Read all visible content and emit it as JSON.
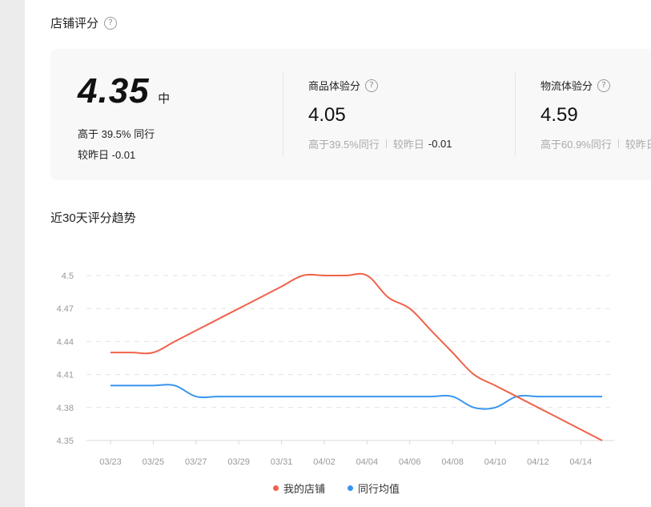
{
  "header": {
    "title": "店铺评分",
    "help_icon": "question-circle-icon"
  },
  "overall": {
    "score": "4.35",
    "level": "中",
    "percentile_text": "高于 39.5% 同行",
    "change_text": "较昨日 -0.01"
  },
  "metrics": [
    {
      "title": "商品体验分",
      "score": "4.05",
      "percentile_text": "高于39.5%同行",
      "change_label": "较昨日",
      "change_value": "-0.01"
    },
    {
      "title": "物流体验分",
      "score": "4.59",
      "percentile_text": "高于60.9%同行",
      "change_label": "较昨日",
      "change_value": ""
    }
  ],
  "trend": {
    "title": "近30天评分趋势"
  },
  "colors": {
    "my_store": "#f0624a",
    "peer_avg": "#3a94ee"
  },
  "chart_data": {
    "type": "line",
    "x": [
      "03/23",
      "03/24",
      "03/25",
      "03/26",
      "03/27",
      "03/28",
      "03/29",
      "03/30",
      "03/31",
      "04/01",
      "04/02",
      "04/03",
      "04/04",
      "04/05",
      "04/06",
      "04/07",
      "04/08",
      "04/09",
      "04/10",
      "04/11",
      "04/12",
      "04/13",
      "04/14",
      "04/15"
    ],
    "x_tick_labels": [
      "03/23",
      "03/25",
      "03/27",
      "03/29",
      "03/31",
      "04/02",
      "04/04",
      "04/06",
      "04/08",
      "04/10",
      "04/12",
      "04/14"
    ],
    "y_tick_labels": [
      "4.5",
      "4.47",
      "4.44",
      "4.41",
      "4.38",
      "4.35"
    ],
    "ylim": [
      4.35,
      4.5
    ],
    "grid": true,
    "legend_position": "bottom",
    "series": [
      {
        "name": "我的店铺",
        "color": "#f0624a",
        "values": [
          4.43,
          4.43,
          4.43,
          4.44,
          4.45,
          4.46,
          4.47,
          4.48,
          4.49,
          4.5,
          4.5,
          4.5,
          4.5,
          4.48,
          4.47,
          4.45,
          4.43,
          4.41,
          4.4,
          4.39,
          4.38,
          4.37,
          4.36,
          4.35
        ]
      },
      {
        "name": "同行均值",
        "color": "#3a94ee",
        "values": [
          4.4,
          4.4,
          4.4,
          4.4,
          4.39,
          4.39,
          4.39,
          4.39,
          4.39,
          4.39,
          4.39,
          4.39,
          4.39,
          4.39,
          4.39,
          4.39,
          4.39,
          4.38,
          4.38,
          4.39,
          4.39,
          4.39,
          4.39,
          4.39
        ]
      }
    ]
  }
}
